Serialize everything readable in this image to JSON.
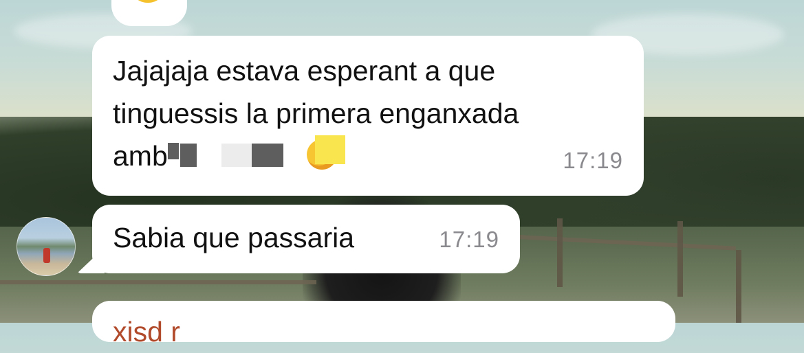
{
  "conversation": {
    "messages": [
      {
        "lines": [
          "Jajajaja estava esperant a que",
          "tinguessis la primera enganxada",
          "amb"
        ],
        "time": "17:19"
      },
      {
        "text": "Sabia que passaria",
        "time": "17:19"
      },
      {
        "text": "xisd r"
      }
    ]
  },
  "icons": {
    "reaction": "laughing-emoji",
    "inline": "grinning-emoji",
    "avatar": "contact-avatar"
  },
  "colors": {
    "bubble": "#ffffff",
    "timestamp": "#8a8a8e",
    "partial_text": "#b14a2a"
  }
}
